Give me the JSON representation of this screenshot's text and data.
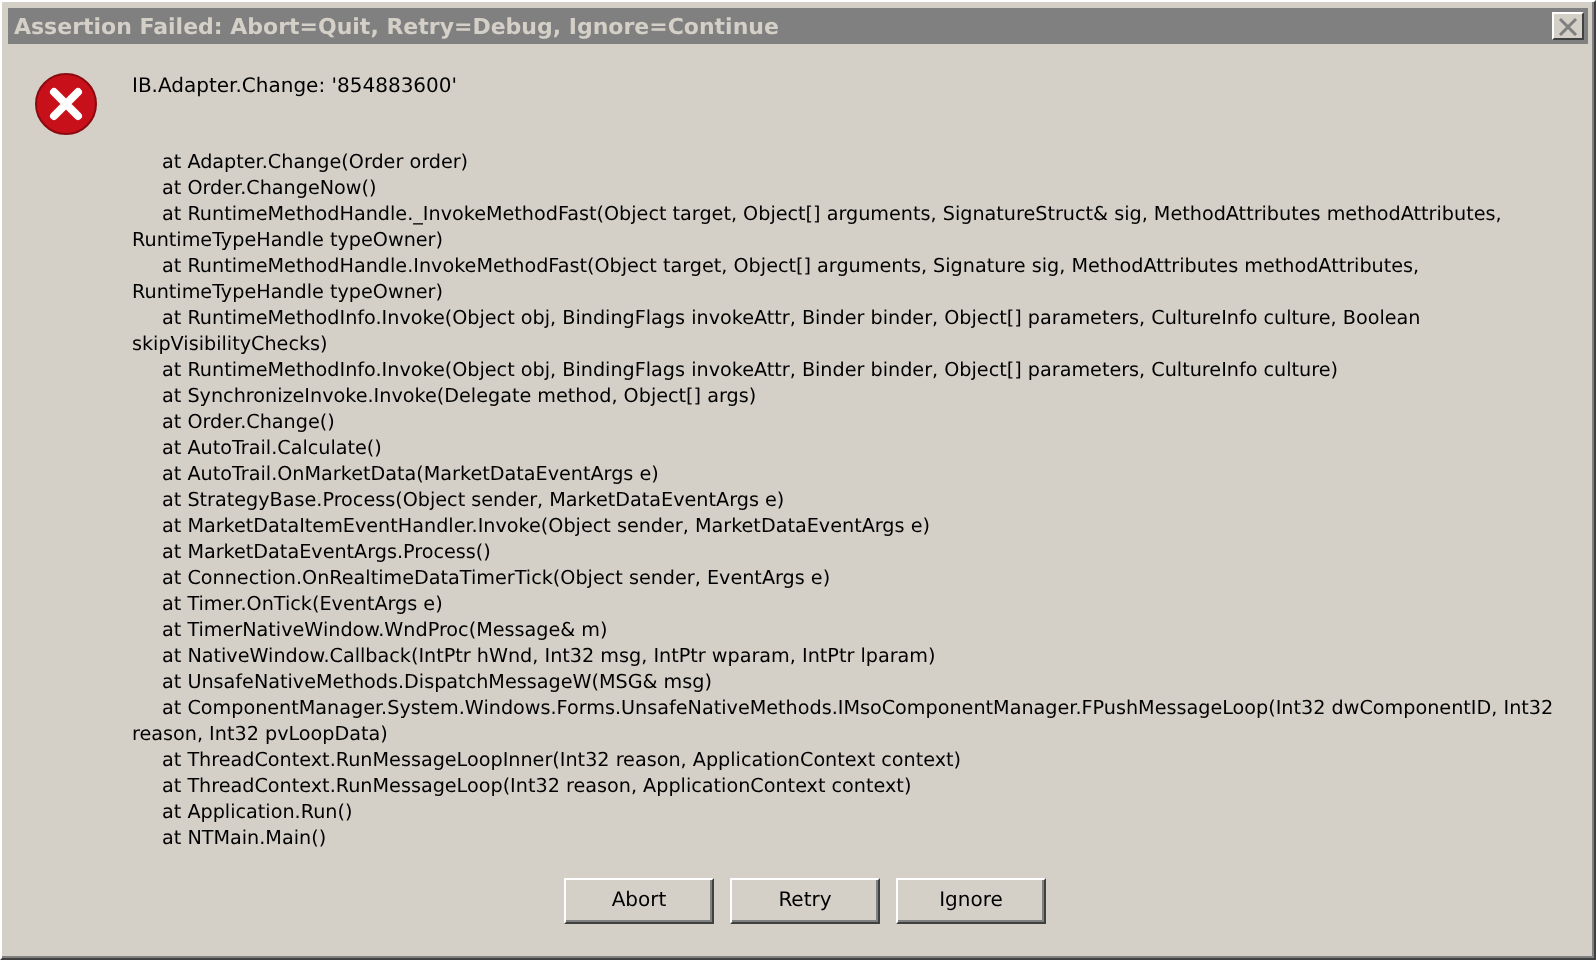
{
  "window": {
    "title": "Assertion Failed: Abort=Quit, Retry=Debug, Ignore=Continue",
    "active": false
  },
  "message": {
    "heading": "IB.Adapter.Change: '854883600'",
    "frames": [
      {
        "lines": [
          "at Adapter.Change(Order order)"
        ]
      },
      {
        "lines": [
          "at Order.ChangeNow()"
        ]
      },
      {
        "lines": [
          "at RuntimeMethodHandle._InvokeMethodFast(Object target, Object[] arguments, SignatureStruct& sig, MethodAttributes methodAttributes,",
          "RuntimeTypeHandle typeOwner)"
        ]
      },
      {
        "lines": [
          "at RuntimeMethodHandle.InvokeMethodFast(Object target, Object[] arguments, Signature sig, MethodAttributes methodAttributes,",
          "RuntimeTypeHandle typeOwner)"
        ]
      },
      {
        "lines": [
          "at RuntimeMethodInfo.Invoke(Object obj, BindingFlags invokeAttr, Binder binder, Object[] parameters, CultureInfo culture, Boolean",
          "skipVisibilityChecks)"
        ]
      },
      {
        "lines": [
          "at RuntimeMethodInfo.Invoke(Object obj, BindingFlags invokeAttr, Binder binder, Object[] parameters, CultureInfo culture)"
        ]
      },
      {
        "lines": [
          "at SynchronizeInvoke.Invoke(Delegate method, Object[] args)"
        ]
      },
      {
        "lines": [
          "at Order.Change()"
        ]
      },
      {
        "lines": [
          "at AutoTrail.Calculate()"
        ]
      },
      {
        "lines": [
          "at AutoTrail.OnMarketData(MarketDataEventArgs e)"
        ]
      },
      {
        "lines": [
          "at StrategyBase.Process(Object sender, MarketDataEventArgs e)"
        ]
      },
      {
        "lines": [
          "at MarketDataItemEventHandler.Invoke(Object sender, MarketDataEventArgs e)"
        ]
      },
      {
        "lines": [
          "at MarketDataEventArgs.Process()"
        ]
      },
      {
        "lines": [
          "at Connection.OnRealtimeDataTimerTick(Object sender, EventArgs e)"
        ]
      },
      {
        "lines": [
          "at Timer.OnTick(EventArgs e)"
        ]
      },
      {
        "lines": [
          "at TimerNativeWindow.WndProc(Message& m)"
        ]
      },
      {
        "lines": [
          "at NativeWindow.Callback(IntPtr hWnd, Int32 msg, IntPtr wparam, IntPtr lparam)"
        ]
      },
      {
        "lines": [
          "at UnsafeNativeMethods.DispatchMessageW(MSG& msg)"
        ]
      },
      {
        "lines": [
          "at ComponentManager.System.Windows.Forms.UnsafeNativeMethods.IMsoComponentManager.FPushMessageLoop(Int32 dwComponentID, Int32",
          "reason, Int32 pvLoopData)"
        ]
      },
      {
        "lines": [
          "at ThreadContext.RunMessageLoopInner(Int32 reason, ApplicationContext context)"
        ]
      },
      {
        "lines": [
          "at ThreadContext.RunMessageLoop(Int32 reason, ApplicationContext context)"
        ]
      },
      {
        "lines": [
          "at Application.Run()"
        ]
      },
      {
        "lines": [
          "at NTMain.Main()"
        ]
      }
    ]
  },
  "buttons": [
    {
      "label": "Abort"
    },
    {
      "label": "Retry"
    },
    {
      "label": "Ignore"
    }
  ]
}
